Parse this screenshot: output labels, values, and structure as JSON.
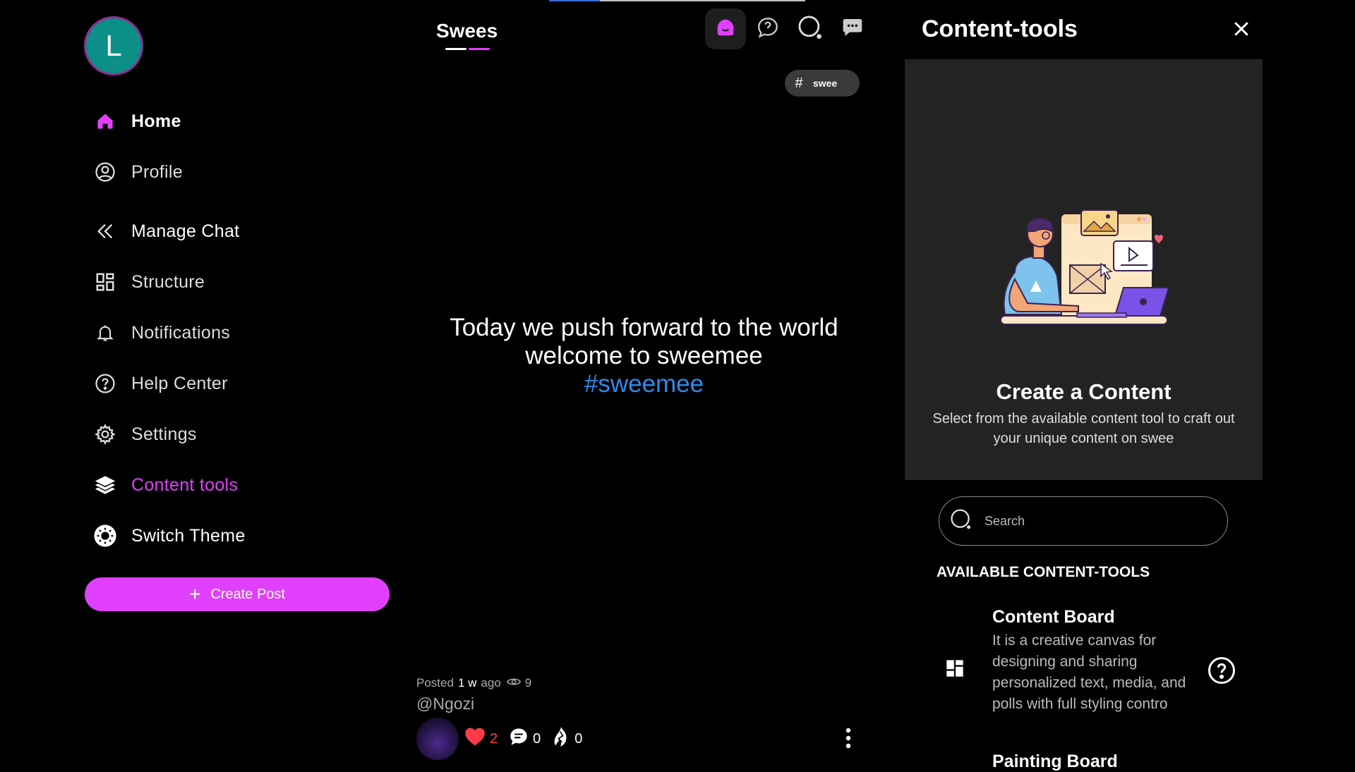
{
  "avatar": {
    "letter": "L"
  },
  "sidebar": {
    "items": [
      {
        "label": "Home",
        "icon": "home-icon"
      },
      {
        "label": "Profile",
        "icon": "user-circle-icon"
      },
      {
        "label": "Manage Chat",
        "icon": "double-chevron-left-icon"
      },
      {
        "label": "Structure",
        "icon": "grid-icon"
      },
      {
        "label": "Notifications",
        "icon": "bell-icon"
      },
      {
        "label": "Help Center",
        "icon": "help-icon"
      },
      {
        "label": "Settings",
        "icon": "gear-icon"
      },
      {
        "label": "Content tools",
        "icon": "layers-icon"
      },
      {
        "label": "Switch Theme",
        "icon": "theme-icon"
      }
    ],
    "create_post": "Create Post"
  },
  "feed": {
    "tab": "Swees",
    "tag_pill": {
      "hash": "#",
      "text": "swee"
    },
    "post": {
      "line1": "Today we push forward to the world",
      "line2": "welcome to sweemee",
      "hashtag": "#sweemee",
      "posted": "Posted",
      "time": "1 w",
      "ago": "ago",
      "views": "9",
      "user": "@Ngozi",
      "likes": "2",
      "comments": "0",
      "shares": "0"
    }
  },
  "panel": {
    "title": "Content-tools",
    "card_title": "Create a Content",
    "card_desc": "Select from the available content tool to craft out your unique content on swee",
    "search_placeholder": "Search",
    "available_title": "AVAILABLE CONTENT-TOOLS",
    "tools": [
      {
        "name": "Content Board",
        "desc": "It is a creative canvas for designing and sharing personalized text, media, and polls with full styling contro"
      },
      {
        "name": "Painting Board"
      }
    ]
  },
  "colors": {
    "accent": "#e040fb",
    "hashtag": "#2e8bea",
    "like": "#ff3b47",
    "avatar_bg": "#0b8f86"
  }
}
